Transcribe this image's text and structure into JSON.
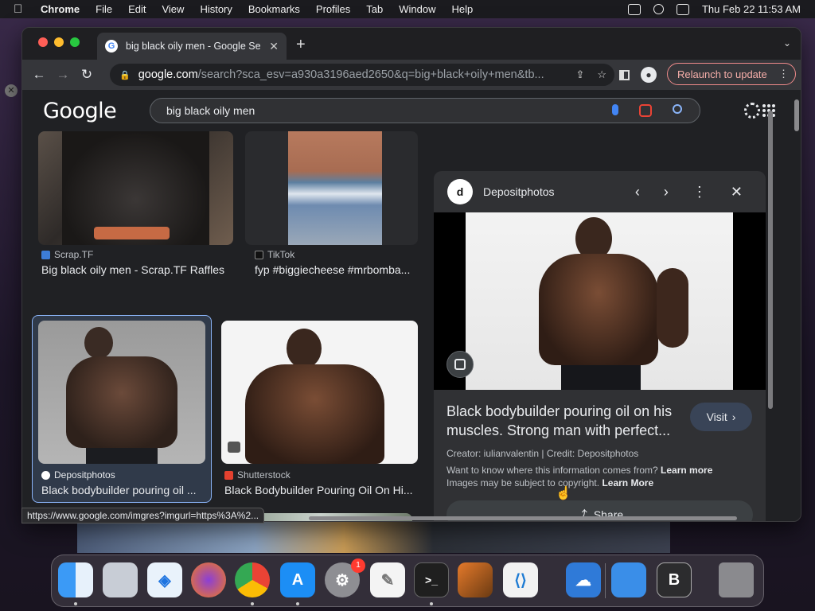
{
  "menubar": {
    "app": "Chrome",
    "items": [
      "File",
      "Edit",
      "View",
      "History",
      "Bookmarks",
      "Profiles",
      "Tab",
      "Window",
      "Help"
    ],
    "datetime": "Thu Feb 22  11:53 AM"
  },
  "browser": {
    "tab_title": "big black oily men - Google Se",
    "url_host": "google.com",
    "url_path": "/search?sca_esv=a930a3196aed2650&q=big+black+oily+men&tb...",
    "relaunch_label": "Relaunch to update",
    "status_url": "https://www.google.com/imgres?imgurl=https%3A%2..."
  },
  "google": {
    "logo": "Google",
    "query": "big black oily men"
  },
  "results": [
    {
      "source": "Scrap.TF",
      "title": "Big black oily men - Scrap.TF Raffles"
    },
    {
      "source": "TikTok",
      "title": "fyp #biggiecheese #mrbomba..."
    },
    {
      "source": "Depositphotos",
      "title": "Black bodybuilder pouring oil ..."
    },
    {
      "source": "Shutterstock",
      "title": "Black Bodybuilder Pouring Oil On Hi..."
    }
  ],
  "preview": {
    "source": "Depositphotos",
    "title": "Black bodybuilder pouring oil on his muscles. Strong man with perfect...",
    "visit_label": "Visit",
    "credit": "Creator: iulianvalentin | Credit: Depositphotos",
    "info_line": "Want to know where this information comes from?",
    "info_link": "Learn more",
    "copyright_line": "Images may be subject to copyright.",
    "copyright_link": "Learn More",
    "share_label": "Share"
  },
  "dock": {
    "settings_badge": "1",
    "apps": [
      "finder",
      "launchpad",
      "safari",
      "firefox",
      "chrome",
      "app-store",
      "system-settings",
      "textedit",
      "terminal",
      "garageband",
      "vscode",
      "weather",
      "keynote",
      "bbedit",
      "trash"
    ]
  }
}
